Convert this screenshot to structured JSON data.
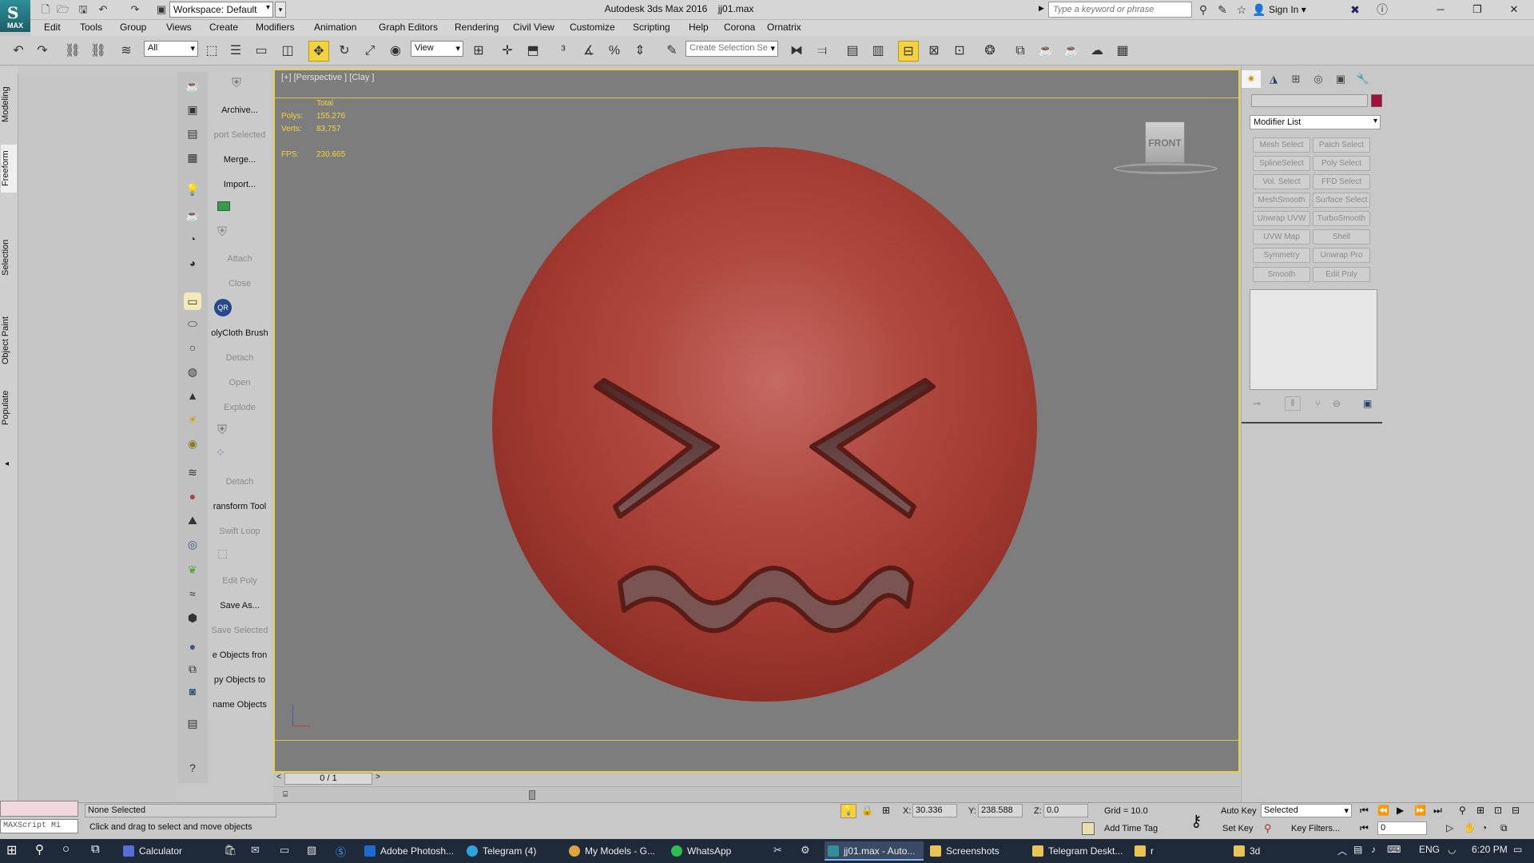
{
  "titlebar": {
    "app_title": "Autodesk 3ds Max 2016",
    "file_name": "jj01.max",
    "workspace": "Workspace: Default",
    "logo_text": "MAX",
    "search_placeholder": "Type a keyword or phrase",
    "sign_in": "Sign In"
  },
  "menu": [
    "Edit",
    "Tools",
    "Group",
    "Views",
    "Create",
    "Modifiers",
    "Animation",
    "Graph Editors",
    "Rendering",
    "Civil View",
    "Customize",
    "Scripting",
    "Help",
    "Corona",
    "Ornatrix"
  ],
  "toolbar": {
    "selection_filter": "All",
    "ref_coord": "View",
    "named_selection": "Create Selection Se"
  },
  "ribbon_tabs": [
    "Modeling",
    "Freeform",
    "Selection",
    "Object Paint",
    "Populate"
  ],
  "commands": [
    {
      "label": "Archive...",
      "dim": false
    },
    {
      "label": "port Selected",
      "dim": true
    },
    {
      "label": "Merge...",
      "dim": false
    },
    {
      "label": "Import...",
      "dim": false
    },
    {
      "label": "Attach",
      "dim": true
    },
    {
      "label": "Close",
      "dim": true
    },
    {
      "label": "olyCloth Brush",
      "dim": false
    },
    {
      "label": "Detach",
      "dim": true
    },
    {
      "label": "Open",
      "dim": true
    },
    {
      "label": "Explode",
      "dim": true
    },
    {
      "label": "Detach",
      "dim": true
    },
    {
      "label": "ransform Tool",
      "dim": false
    },
    {
      "label": "Swift Loop",
      "dim": true
    },
    {
      "label": "Edit Poly",
      "dim": true
    },
    {
      "label": "Save As...",
      "dim": false
    },
    {
      "label": "Save Selected",
      "dim": true
    },
    {
      "label": "e Objects fron",
      "dim": false
    },
    {
      "label": "py Objects to",
      "dim": false
    },
    {
      "label": "name Objects",
      "dim": false
    }
  ],
  "viewport": {
    "label": "[+] [Perspective ] [Clay ]",
    "stats_header": "Total",
    "polys_label": "Polys:",
    "polys": "155,276",
    "verts_label": "Verts:",
    "verts": "83,757",
    "fps_label": "FPS:",
    "fps": "230.665",
    "viewcube": "FRONT"
  },
  "command_panel": {
    "modifier_list": "Modifier List",
    "modifier_buttons": [
      "Mesh Select",
      "Patch Select",
      "SplineSelect",
      "Poly Select",
      "Vol. Select",
      "FFD Select",
      "MeshSmooth",
      "Surface Select",
      "Unwrap UVW",
      "TurboSmooth",
      "UVW Map",
      "Shell",
      "Symmetry",
      "Unwrap Pro",
      "Smooth",
      "Edit Poly"
    ],
    "object_color": "#a1103b"
  },
  "timeline": {
    "frame": "0 / 1"
  },
  "status": {
    "selection": "None Selected",
    "prompt": "Click and drag to select and move objects",
    "maxscript": "MAXScript Mi",
    "x_label": "X:",
    "x": "30.336",
    "y_label": "Y:",
    "y": "238.588",
    "z_label": "Z:",
    "z": "0.0",
    "grid": "Grid = 10.0",
    "add_time_tag": "Add Time Tag",
    "auto_key": "Auto Key",
    "set_key": "Set Key",
    "key_mode": "Selected",
    "key_filters": "Key Filters...",
    "frame_field": "0"
  },
  "taskbar": {
    "apps": [
      {
        "label": "Calculator",
        "color": "#5a6fd6",
        "active": false
      },
      {
        "label": "Adobe Photosh...",
        "color": "#1f6ad1",
        "active": false
      },
      {
        "label": "Telegram (4)",
        "color": "#2ea6dd",
        "active": false
      },
      {
        "label": "My Models - G...",
        "color": "#e0a53a",
        "active": false
      },
      {
        "label": "WhatsApp",
        "color": "#2fbf4f",
        "active": false
      },
      {
        "label": "jj01.max - Auto...",
        "color": "#2f8f9a",
        "active": true
      },
      {
        "label": "Screenshots",
        "color": "#e8c35a",
        "active": false
      },
      {
        "label": "Telegram Deskt...",
        "color": "#e8c35a",
        "active": false
      },
      {
        "label": "r",
        "color": "#e8c35a",
        "active": false
      },
      {
        "label": "3d",
        "color": "#e8c35a",
        "active": false
      }
    ],
    "lang": "ENG",
    "time": "6:20 PM"
  }
}
